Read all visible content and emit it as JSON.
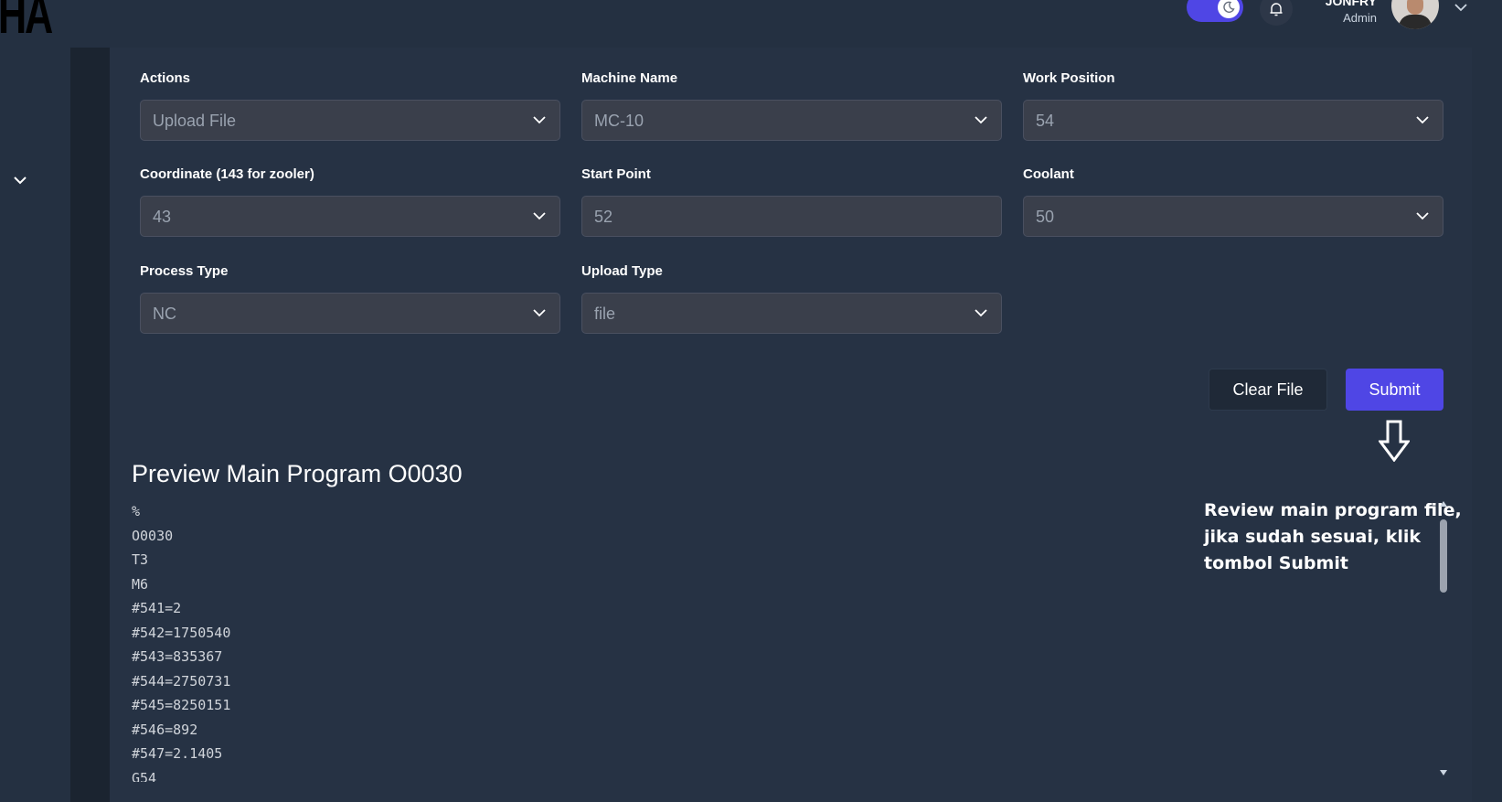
{
  "header": {
    "logo_text": "HA",
    "user_name": "JONFRY",
    "user_role": "Admin",
    "icons": [
      "moon-icon",
      "bell-icon",
      "chevron-down-icon"
    ]
  },
  "form": {
    "actions": {
      "label": "Actions",
      "value": "Upload File"
    },
    "machine_name": {
      "label": "Machine Name",
      "value": "MC-10"
    },
    "work_position": {
      "label": "Work Position",
      "value": "54"
    },
    "coordinate": {
      "label": "Coordinate (143 for zooler)",
      "value": "43"
    },
    "start_point": {
      "label": "Start Point",
      "value": "52"
    },
    "coolant": {
      "label": "Coolant",
      "value": "50"
    },
    "process_type": {
      "label": "Process Type",
      "value": "NC"
    },
    "upload_type": {
      "label": "Upload Type",
      "value": "file"
    }
  },
  "buttons": {
    "clear_label": "Clear File",
    "submit_label": "Submit"
  },
  "annotation": {
    "text": "Review main program file, jika sudah sesuai, klik tombol Submit"
  },
  "preview": {
    "title": "Preview Main Program O0030",
    "lines": [
      "%",
      "O0030",
      "T3",
      "M6",
      "#541=2",
      "#542=1750540",
      "#543=835367",
      "#544=2750731",
      "#545=8250151",
      "#546=892",
      "#547=2.1405",
      "G54"
    ]
  },
  "colors": {
    "accent": "#4f46e5",
    "background": "#243041",
    "panel": "#263244",
    "input_bg": "#3a3f4b"
  }
}
